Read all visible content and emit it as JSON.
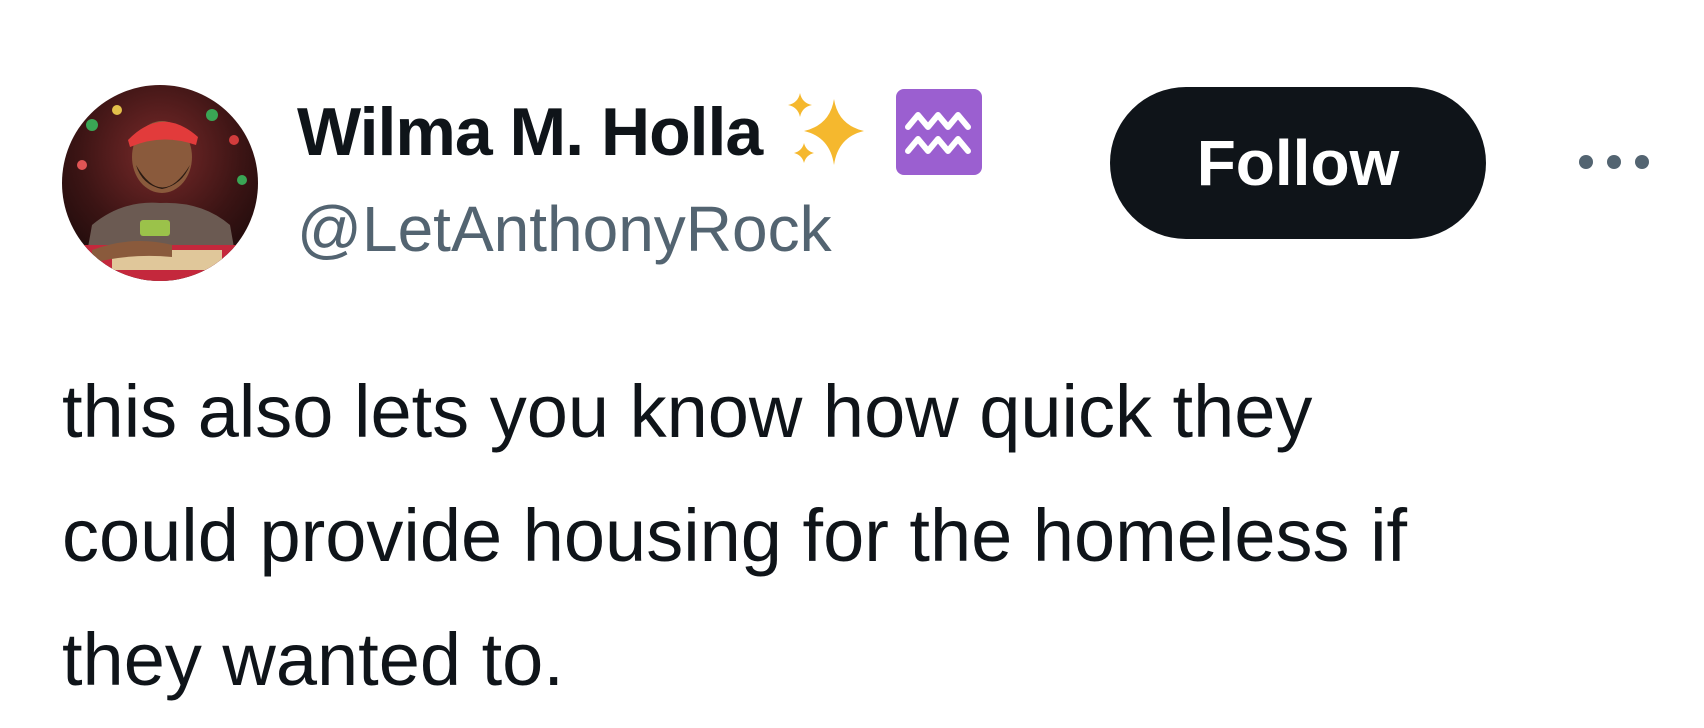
{
  "author": {
    "display_name": "Wilma M. Holla",
    "handle": "@LetAnthonyRock",
    "badges": [
      "sparkles-icon",
      "aquarius-icon"
    ],
    "avatar_icon": "profile-photo"
  },
  "actions": {
    "follow_label": "Follow",
    "more_icon": "more-icon"
  },
  "tweet": {
    "text": "this also lets you know how quick they\ncould provide housing for the homeless if\nthey wanted to."
  },
  "colors": {
    "text_primary": "#0f1419",
    "text_secondary": "#536471",
    "follow_bg": "#0f1419",
    "follow_text": "#ffffff",
    "sparkle": "#f5b82e",
    "aquarius_bg": "#9b5fd0"
  }
}
